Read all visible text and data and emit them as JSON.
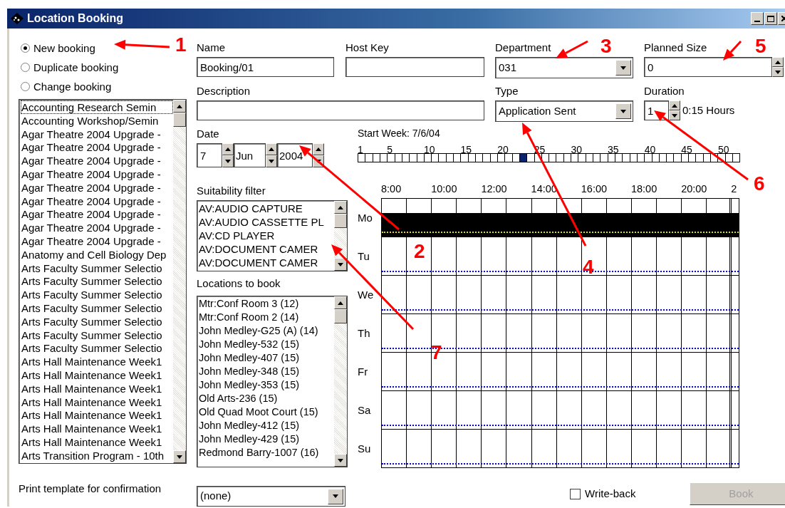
{
  "window": {
    "title": "Location Booking"
  },
  "booking_mode": [
    {
      "label": "New booking",
      "selected": true
    },
    {
      "label": "Duplicate booking",
      "selected": false
    },
    {
      "label": "Change booking",
      "selected": false
    }
  ],
  "bookings_list": [
    {
      "text": "Accounting Research Semin",
      "focused": true
    },
    {
      "text": "Accounting Workshop/Semin",
      "focused": false
    },
    {
      "text": "Agar Theatre 2004 Upgrade -",
      "focused": false
    },
    {
      "text": "Agar Theatre 2004 Upgrade -",
      "focused": false
    },
    {
      "text": "Agar Theatre 2004 Upgrade -",
      "focused": false
    },
    {
      "text": "Agar Theatre 2004 Upgrade -",
      "focused": false
    },
    {
      "text": "Agar Theatre 2004 Upgrade -",
      "focused": false
    },
    {
      "text": "Agar Theatre 2004 Upgrade -",
      "focused": false
    },
    {
      "text": "Agar Theatre 2004 Upgrade -",
      "focused": false
    },
    {
      "text": "Agar Theatre 2004 Upgrade -",
      "focused": false
    },
    {
      "text": "Agar Theatre 2004 Upgrade -",
      "focused": false
    },
    {
      "text": "Anatomy and Cell Biology Dep",
      "focused": false
    },
    {
      "text": "Arts Faculty Summer Selectio",
      "focused": false
    },
    {
      "text": "Arts Faculty Summer Selectio",
      "focused": false
    },
    {
      "text": "Arts Faculty Summer Selectio",
      "focused": false
    },
    {
      "text": "Arts Faculty Summer Selectio",
      "focused": false
    },
    {
      "text": "Arts Faculty Summer Selectio",
      "focused": false
    },
    {
      "text": "Arts Faculty Summer Selectio",
      "focused": false
    },
    {
      "text": "Arts Faculty Summer Selectio",
      "focused": false
    },
    {
      "text": "Arts Hall Maintenance Week1",
      "focused": false
    },
    {
      "text": "Arts Hall Maintenance Week1",
      "focused": false
    },
    {
      "text": "Arts Hall Maintenance Week1",
      "focused": false
    },
    {
      "text": "Arts Hall Maintenance Week1",
      "focused": false
    },
    {
      "text": "Arts Hall Maintenance Week1",
      "focused": false
    },
    {
      "text": "Arts Hall Maintenance Week1",
      "focused": false
    },
    {
      "text": "Arts Hall Maintenance Week1",
      "focused": false
    },
    {
      "text": "Arts Transition Program - 10th",
      "focused": false
    }
  ],
  "print_template": {
    "label": "Print template for confirmation",
    "value": "(none)"
  },
  "name": {
    "label": "Name",
    "value": "Booking/01"
  },
  "host_key": {
    "label": "Host Key"
  },
  "department": {
    "label": "Department",
    "value": "031"
  },
  "planned_size": {
    "label": "Planned Size",
    "value": "0"
  },
  "description": {
    "label": "Description"
  },
  "type": {
    "label": "Type",
    "value": "Application Sent"
  },
  "duration": {
    "label": "Duration",
    "value": "1",
    "reading": "0:15 Hours"
  },
  "date": {
    "label": "Date",
    "day": "7",
    "month": "Jun",
    "year": "2004"
  },
  "start_week": {
    "label": "Start Week: 7/6/04",
    "ticks": [
      "1",
      "5",
      "10",
      "15",
      "20",
      "25",
      "30",
      "35",
      "40",
      "45",
      "50"
    ],
    "weeks": [
      {
        "selected": false
      },
      {
        "selected": false
      },
      {
        "selected": false
      },
      {
        "selected": false
      },
      {
        "selected": false
      },
      {
        "selected": false
      },
      {
        "selected": false
      },
      {
        "selected": false
      },
      {
        "selected": false
      },
      {
        "selected": false
      },
      {
        "selected": false
      },
      {
        "selected": false
      },
      {
        "selected": false
      },
      {
        "selected": false
      },
      {
        "selected": false
      },
      {
        "selected": false
      },
      {
        "selected": false
      },
      {
        "selected": false
      },
      {
        "selected": false
      },
      {
        "selected": false
      },
      {
        "selected": false
      },
      {
        "selected": false
      },
      {
        "selected": true
      },
      {
        "selected": false
      },
      {
        "selected": false
      },
      {
        "selected": false
      },
      {
        "selected": false
      },
      {
        "selected": false
      },
      {
        "selected": false
      },
      {
        "selected": false
      },
      {
        "selected": false
      },
      {
        "selected": false
      },
      {
        "selected": false
      },
      {
        "selected": false
      },
      {
        "selected": false
      },
      {
        "selected": false
      },
      {
        "selected": false
      },
      {
        "selected": false
      },
      {
        "selected": false
      },
      {
        "selected": false
      },
      {
        "selected": false
      },
      {
        "selected": false
      },
      {
        "selected": false
      },
      {
        "selected": false
      },
      {
        "selected": false
      },
      {
        "selected": false
      },
      {
        "selected": false
      },
      {
        "selected": false
      },
      {
        "selected": false
      },
      {
        "selected": false
      },
      {
        "selected": false
      },
      {
        "selected": false
      }
    ]
  },
  "suitability_filter": {
    "label": "Suitability filter",
    "items": [
      "AV:AUDIO CAPTURE",
      "AV:AUDIO CASSETTE PL",
      "AV:CD PLAYER",
      "AV:DOCUMENT CAMER",
      "AV:DOCUMENT CAMER"
    ]
  },
  "locations": {
    "label": "Locations to book",
    "items": [
      "Mtr:Conf Room 3 (12)",
      "Mtr:Conf Room 2 (14)",
      "John Medley-G25 (A) (14)",
      "John Medley-532 (15)",
      "John Medley-407 (15)",
      "John Medley-348 (15)",
      "John Medley-353 (15)",
      "Old Arts-236 (15)",
      "Old Quad Moot Court (15)",
      "John Medley-412 (15)",
      "John Medley-429 (15)",
      "Redmond Barry-1007 (16)"
    ]
  },
  "schedule": {
    "hours": [
      "8:00",
      "10:00",
      "12:00",
      "14:00",
      "16:00",
      "18:00",
      "20:00",
      "2"
    ],
    "days": [
      {
        "label": "Mo",
        "booked": true
      },
      {
        "label": "Tu",
        "booked": false
      },
      {
        "label": "We",
        "booked": false
      },
      {
        "label": "Th",
        "booked": false
      },
      {
        "label": "Fr",
        "booked": false
      },
      {
        "label": "Sa",
        "booked": false
      },
      {
        "label": "Su",
        "booked": false
      }
    ]
  },
  "write_back": {
    "label": "Write-back",
    "checked": false
  },
  "book_button": {
    "label": "Book",
    "disabled": true
  },
  "annotations": [
    {
      "label": "1"
    },
    {
      "label": "2"
    },
    {
      "label": "3"
    },
    {
      "label": "4"
    },
    {
      "label": "5"
    },
    {
      "label": "6"
    },
    {
      "label": "7"
    }
  ]
}
